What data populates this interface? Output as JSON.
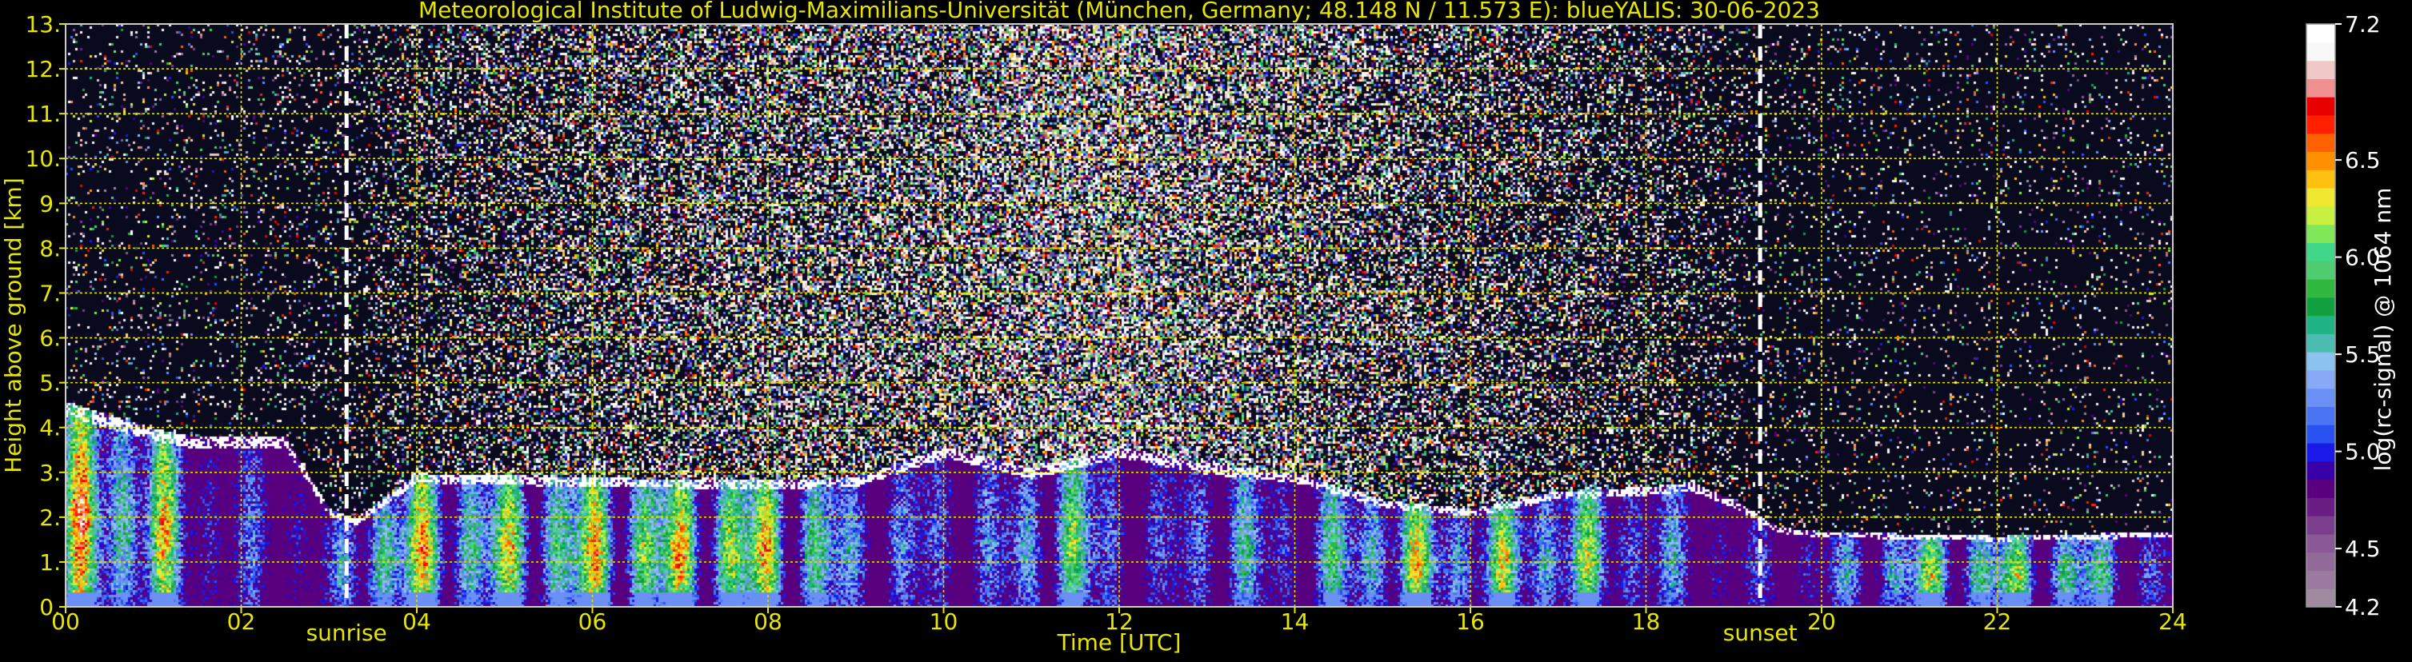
{
  "chart_data": {
    "type": "heatmap",
    "title": "Meteorological Institute of Ludwig-Maximilians-Universität (München, Germany; 48.148 N / 11.573 E):    blueYALIS: 30-06-2023",
    "xlabel": "Time [UTC]",
    "ylabel": "Height above ground [km]",
    "xlim": [
      0,
      24
    ],
    "ylim": [
      0,
      13
    ],
    "x_ticks": [
      {
        "value": 0,
        "label": "00"
      },
      {
        "value": 2,
        "label": "02"
      },
      {
        "value": 4,
        "label": "04"
      },
      {
        "value": 6,
        "label": "06"
      },
      {
        "value": 8,
        "label": "08"
      },
      {
        "value": 10,
        "label": "10"
      },
      {
        "value": 12,
        "label": "12"
      },
      {
        "value": 14,
        "label": "14"
      },
      {
        "value": 16,
        "label": "16"
      },
      {
        "value": 18,
        "label": "18"
      },
      {
        "value": 20,
        "label": "20"
      },
      {
        "value": 22,
        "label": "22"
      },
      {
        "value": 24,
        "label": "24"
      }
    ],
    "y_ticks": [
      {
        "value": 0,
        "label": "0."
      },
      {
        "value": 1,
        "label": "1."
      },
      {
        "value": 2,
        "label": "2."
      },
      {
        "value": 3,
        "label": "3."
      },
      {
        "value": 4,
        "label": "4."
      },
      {
        "value": 5,
        "label": "5."
      },
      {
        "value": 6,
        "label": "6."
      },
      {
        "value": 7,
        "label": "7."
      },
      {
        "value": 8,
        "label": "8."
      },
      {
        "value": 9,
        "label": "9."
      },
      {
        "value": 10,
        "label": "10."
      },
      {
        "value": 11,
        "label": "11."
      },
      {
        "value": 12,
        "label": "12."
      },
      {
        "value": 13,
        "label": "13."
      }
    ],
    "grid": true,
    "grid_color": "#e0e000",
    "events": [
      {
        "label": "sunrise",
        "time": 3.2
      },
      {
        "label": "sunset",
        "time": 19.3
      }
    ],
    "colorbar": {
      "label": "log(rc-signal) @ 1064 nm",
      "range": [
        4.2,
        7.2
      ],
      "ticks": [
        {
          "value": 4.2,
          "label": "4.2"
        },
        {
          "value": 4.5,
          "label": "4.5"
        },
        {
          "value": 5.0,
          "label": "5.0"
        },
        {
          "value": 5.5,
          "label": "5.5"
        },
        {
          "value": 6.0,
          "label": "6.0"
        },
        {
          "value": 6.5,
          "label": "6.5"
        },
        {
          "value": 7.2,
          "label": "7.2"
        }
      ],
      "colors": [
        "#a08aa0",
        "#9a7a9e",
        "#926a9a",
        "#8a5896",
        "#7a3e8c",
        "#6a1e84",
        "#58007e",
        "#3a00a8",
        "#1a1ae8",
        "#2a52f0",
        "#4a74f4",
        "#6a90f6",
        "#88aaf6",
        "#8cc2ee",
        "#4abcb0",
        "#20b484",
        "#10a040",
        "#30b840",
        "#50cc70",
        "#40d888",
        "#80e858",
        "#c8f040",
        "#f0e830",
        "#ffc010",
        "#ff9000",
        "#ff6000",
        "#ff2000",
        "#e80000",
        "#f09090",
        "#f0c8c8",
        "#f8f8f8",
        "#ffffff"
      ]
    },
    "features": {
      "pbl_top": [
        [
          0,
          4.6
        ],
        [
          0.5,
          4.3
        ],
        [
          1.0,
          4.0
        ],
        [
          1.5,
          3.8
        ],
        [
          2.0,
          3.8
        ],
        [
          2.5,
          3.8
        ],
        [
          3.0,
          2.2
        ],
        [
          3.3,
          2.0
        ],
        [
          4.0,
          3.0
        ],
        [
          6.0,
          2.9
        ],
        [
          8.0,
          2.85
        ],
        [
          9.0,
          2.9
        ],
        [
          10.0,
          3.6
        ],
        [
          11.0,
          3.1
        ],
        [
          12.0,
          3.6
        ],
        [
          13.0,
          3.2
        ],
        [
          14.0,
          3.0
        ],
        [
          15.0,
          2.4
        ],
        [
          16.0,
          2.2
        ],
        [
          17.0,
          2.6
        ],
        [
          18.0,
          2.7
        ],
        [
          18.5,
          2.8
        ],
        [
          19.0,
          2.4
        ],
        [
          19.5,
          1.8
        ],
        [
          20.0,
          1.7
        ],
        [
          22.0,
          1.6
        ],
        [
          24.0,
          1.7
        ]
      ],
      "aerosol_intensity": [
        [
          0,
          0.9
        ],
        [
          1,
          0.9
        ],
        [
          1.5,
          0.4
        ],
        [
          2,
          0.35
        ],
        [
          3,
          0.3
        ],
        [
          3.5,
          0.9
        ],
        [
          5,
          0.8
        ],
        [
          6,
          0.9
        ],
        [
          8,
          0.95
        ],
        [
          9,
          0.5
        ],
        [
          10,
          0.4
        ],
        [
          10.8,
          0.45
        ],
        [
          11.2,
          0.9
        ],
        [
          11.8,
          0.5
        ],
        [
          12.5,
          0.3
        ],
        [
          13,
          0.6
        ],
        [
          14,
          0.4
        ],
        [
          15,
          0.85
        ],
        [
          16,
          0.7
        ],
        [
          17,
          0.8
        ],
        [
          18,
          0.5
        ],
        [
          19,
          0.3
        ],
        [
          20,
          0.35
        ],
        [
          21,
          0.75
        ],
        [
          22,
          0.8
        ],
        [
          23,
          0.7
        ],
        [
          24,
          0.3
        ]
      ],
      "noise_brightness": [
        [
          0,
          0.1
        ],
        [
          2,
          0.12
        ],
        [
          3.2,
          0.18
        ],
        [
          4,
          0.35
        ],
        [
          6,
          0.55
        ],
        [
          8,
          0.65
        ],
        [
          10,
          0.7
        ],
        [
          11,
          0.85
        ],
        [
          12,
          0.85
        ],
        [
          13,
          0.75
        ],
        [
          15,
          0.6
        ],
        [
          17,
          0.45
        ],
        [
          18.5,
          0.3
        ],
        [
          19.3,
          0.14
        ],
        [
          21,
          0.09
        ],
        [
          24,
          0.08
        ]
      ]
    }
  }
}
